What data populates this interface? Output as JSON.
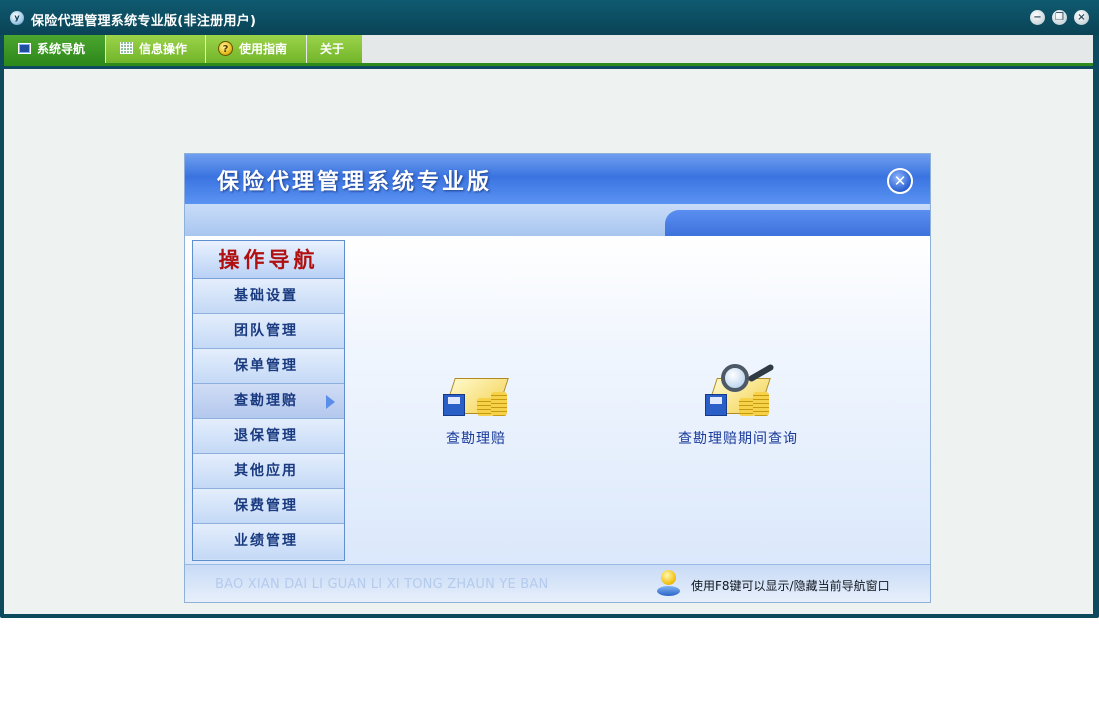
{
  "window": {
    "title": "保险代理管理系统专业版(非注册用户)",
    "app_icon": "y",
    "controls": {
      "minimize": "−",
      "restore": "❐",
      "close": "×"
    }
  },
  "menu": [
    {
      "label": "系统导航",
      "icon": "monitor-icon"
    },
    {
      "label": "信息操作",
      "icon": "grid-icon"
    },
    {
      "label": "使用指南",
      "icon": "help-icon"
    },
    {
      "label": "关于",
      "icon": ""
    }
  ],
  "panel": {
    "title": "保险代理管理系统专业版",
    "close_glyph": "✕",
    "nav_header": "操作导航",
    "nav_items": [
      "基础设置",
      "团队管理",
      "保单管理",
      "查勘理赔",
      "退保管理",
      "其他应用",
      "保费管理",
      "业绩管理"
    ],
    "nav_active_index": 3,
    "features": [
      {
        "label": "查勘理赔",
        "icon": "claims-book-icon"
      },
      {
        "label": "查勘理赔期间查询",
        "icon": "claims-search-icon"
      }
    ],
    "footer_pinyin": "BAO XIAN DAI LI GUAN LI XI TONG ZHAUN YE BAN",
    "footer_tip": "使用F8键可以显示/隐藏当前导航窗口"
  },
  "colors": {
    "titlebar": "#0d4a5e",
    "menu_active": "#2f8a1c",
    "menu_inactive": "#8cc63f",
    "panel_header": "#3b74e0",
    "nav_header_text": "#b01010",
    "nav_text": "#1a3a80"
  }
}
